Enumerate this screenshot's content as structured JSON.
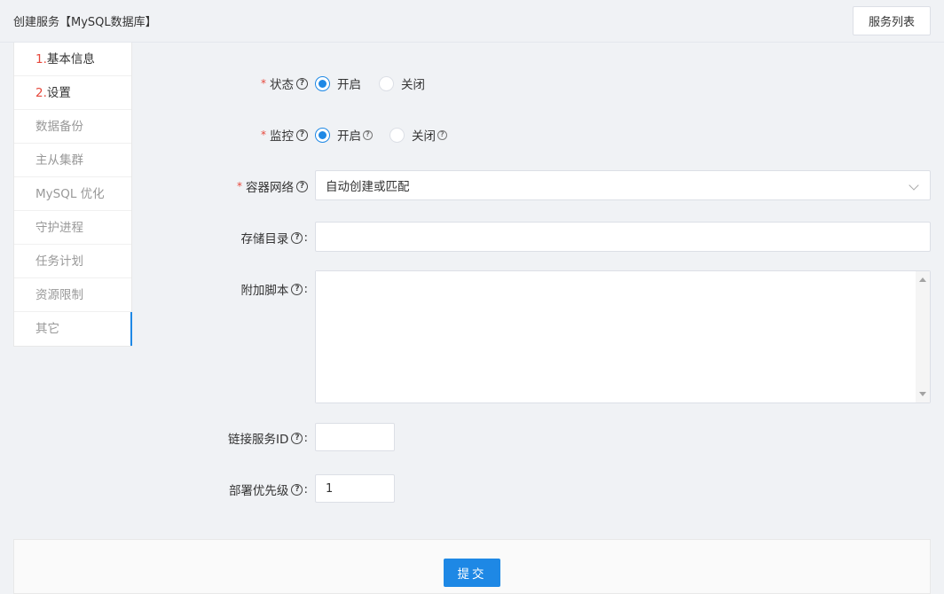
{
  "header": {
    "title": "创建服务【MySQL数据库】",
    "service_list_label": "服务列表"
  },
  "sidebar": {
    "items": [
      {
        "num": "1.",
        "label": "基本信息"
      },
      {
        "num": "2.",
        "label": "设置"
      },
      {
        "num": "",
        "label": "数据备份"
      },
      {
        "num": "",
        "label": "主从集群"
      },
      {
        "num": "",
        "label": "MySQL 优化"
      },
      {
        "num": "",
        "label": "守护进程"
      },
      {
        "num": "",
        "label": "任务计划"
      },
      {
        "num": "",
        "label": "资源限制"
      },
      {
        "num": "",
        "label": "其它"
      }
    ]
  },
  "form": {
    "status": {
      "label": "状态",
      "on": "开启",
      "off": "关闭",
      "selected": "开启"
    },
    "monitor": {
      "label": "监控",
      "on": "开启",
      "off": "关闭",
      "selected": "开启"
    },
    "network": {
      "label": "容器网络",
      "value": "自动创建或匹配"
    },
    "storage_dir": {
      "label": "存储目录",
      "value": ""
    },
    "extra_script": {
      "label": "附加脚本",
      "value": ""
    },
    "link_service_id": {
      "label": "链接服务ID",
      "value": ""
    },
    "deploy_priority": {
      "label": "部署优先级",
      "value": "1"
    },
    "colon": ":",
    "required_mark": "*",
    "help_glyph": "?"
  },
  "footer": {
    "submit_label": "提交"
  },
  "colors": {
    "accent": "#1e88e5",
    "required": "#e6483c"
  }
}
